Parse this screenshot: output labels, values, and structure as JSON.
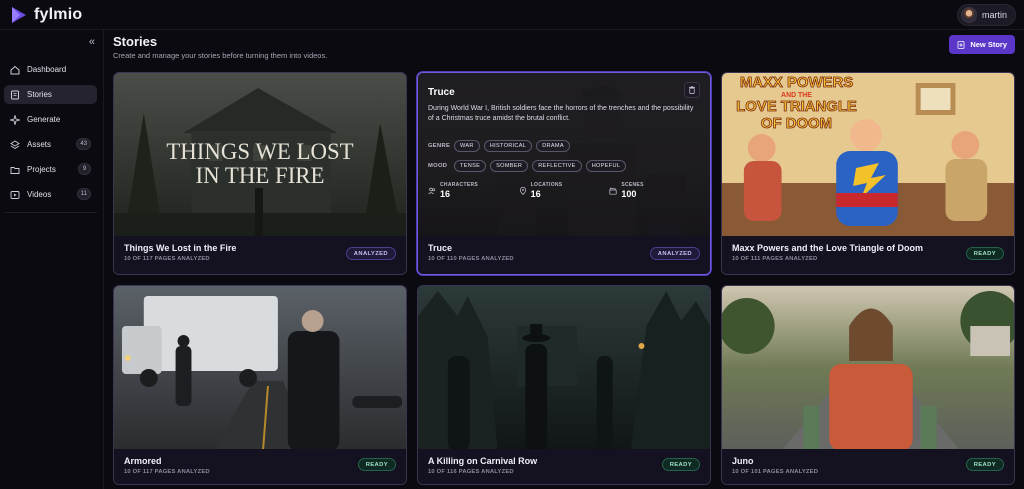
{
  "app": {
    "name": "fylmio"
  },
  "user": {
    "name": "martin"
  },
  "sidebar": {
    "collapse_glyph": "«",
    "items": [
      {
        "label": "Dashboard",
        "icon": "home-icon",
        "count": null,
        "active": false
      },
      {
        "label": "Stories",
        "icon": "book-icon",
        "count": null,
        "active": true
      },
      {
        "label": "Generate",
        "icon": "sparkle-icon",
        "count": null,
        "active": false
      },
      {
        "label": "Assets",
        "icon": "layers-icon",
        "count": "43",
        "active": false
      },
      {
        "label": "Projects",
        "icon": "folder-icon",
        "count": "9",
        "active": false
      },
      {
        "label": "Videos",
        "icon": "play-icon",
        "count": "11",
        "active": false
      }
    ]
  },
  "header": {
    "title": "Stories",
    "subtitle": "Create and manage your stories before turning them into videos.",
    "new_button": "New Story"
  },
  "colors": {
    "accent": "#5a37c8",
    "analyzed": "#c9c0f2",
    "ready": "#9ee0c1"
  },
  "stories": [
    {
      "title": "Things We Lost in the Fire",
      "meta": "10 OF 117 PAGES ANALYZED",
      "status": "ANALYZED",
      "poster_text": "THINGS WE LOST IN THE FIRE"
    },
    {
      "title": "Truce",
      "meta": "10 OF 110 PAGES ANALYZED",
      "status": "ANALYZED",
      "description": "During World War I, British soldiers face the horrors of the trenches and the possibility of a Christmas truce amidst the brutal conflict.",
      "genre_label": "GENRE",
      "genres": [
        "WAR",
        "HISTORICAL",
        "DRAMA"
      ],
      "mood_label": "MOOD",
      "moods": [
        "TENSE",
        "SOMBER",
        "REFLECTIVE",
        "HOPEFUL"
      ],
      "stats": [
        {
          "label": "CHARACTERS",
          "value": "16",
          "icon": "users-icon"
        },
        {
          "label": "LOCATIONS",
          "value": "16",
          "icon": "pin-icon"
        },
        {
          "label": "SCENES",
          "value": "100",
          "icon": "clapper-icon"
        }
      ]
    },
    {
      "title": "Maxx Powers and the Love Triangle of Doom",
      "meta": "10 OF 111 PAGES ANALYZED",
      "status": "READY",
      "poster_line1": "MAXX POWERS",
      "poster_line2": "AND THE",
      "poster_line3": "LOVE TRIANGLE",
      "poster_line4": "OF DOOM"
    },
    {
      "title": "Armored",
      "meta": "10 OF 117 PAGES ANALYZED",
      "status": "READY"
    },
    {
      "title": "A Killing on Carnival Row",
      "meta": "10 OF 116 PAGES ANALYZED",
      "status": "READY"
    },
    {
      "title": "Juno",
      "meta": "10 OF 101 PAGES ANALYZED",
      "status": "READY"
    }
  ]
}
